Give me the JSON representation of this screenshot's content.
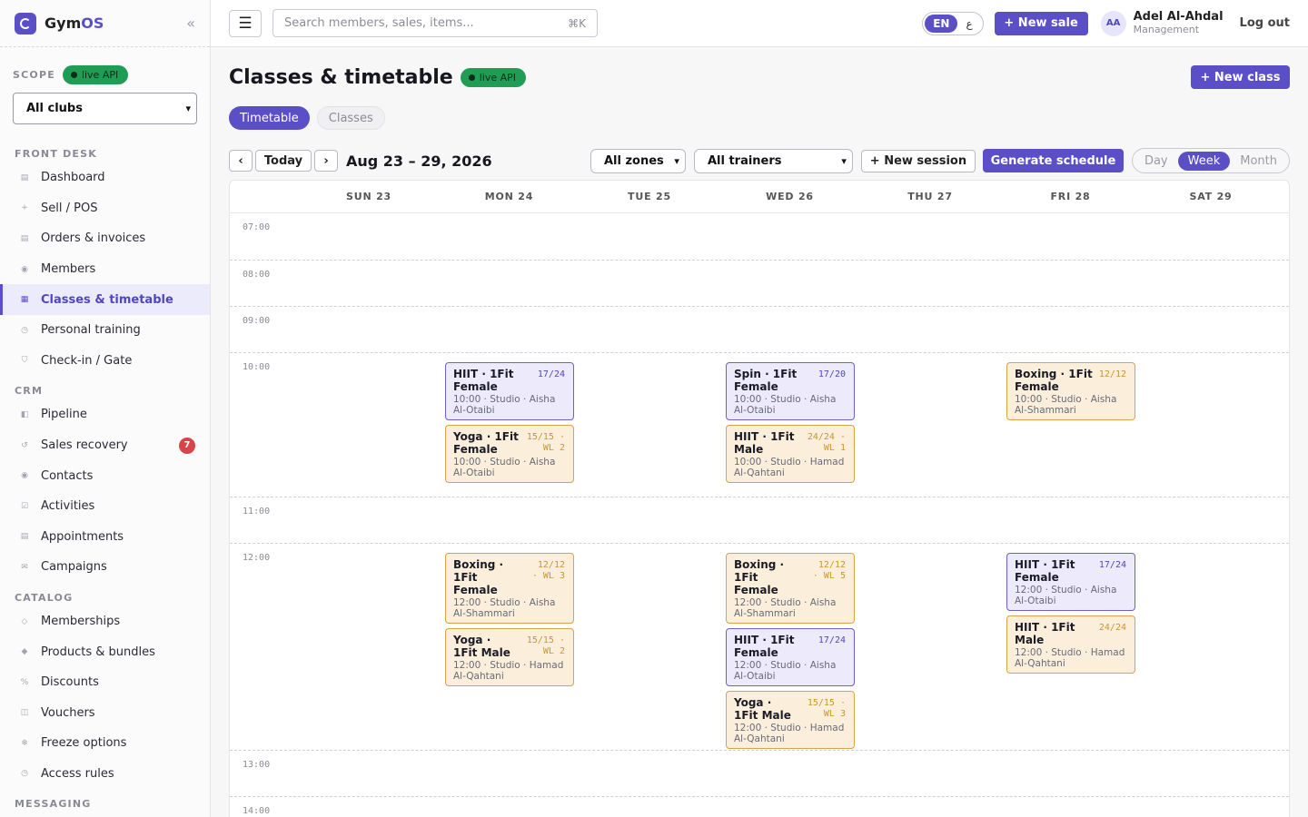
{
  "app": {
    "name_part1": "Gym",
    "name_part2": "OS"
  },
  "sidebar": {
    "scope_label": "SCOPE",
    "live_badge": "live API",
    "club_select": "All clubs",
    "groups": [
      {
        "label": "FRONT DESK",
        "items": [
          {
            "label": "Dashboard",
            "icon": "▤"
          },
          {
            "label": "Sell / POS",
            "icon": "+"
          },
          {
            "label": "Orders & invoices",
            "icon": "▤"
          },
          {
            "label": "Members",
            "icon": "◉"
          },
          {
            "label": "Classes & timetable",
            "icon": "▦",
            "active": true
          },
          {
            "label": "Personal training",
            "icon": "◷"
          },
          {
            "label": "Check-in / Gate",
            "icon": "⛉"
          }
        ]
      },
      {
        "label": "CRM",
        "items": [
          {
            "label": "Pipeline",
            "icon": "◧"
          },
          {
            "label": "Sales recovery",
            "icon": "↺",
            "badge": "7"
          },
          {
            "label": "Contacts",
            "icon": "◉"
          },
          {
            "label": "Activities",
            "icon": "☑"
          },
          {
            "label": "Appointments",
            "icon": "▤"
          },
          {
            "label": "Campaigns",
            "icon": "✉"
          }
        ]
      },
      {
        "label": "CATALOG",
        "items": [
          {
            "label": "Memberships",
            "icon": "◇"
          },
          {
            "label": "Products & bundles",
            "icon": "◆"
          },
          {
            "label": "Discounts",
            "icon": "%"
          },
          {
            "label": "Vouchers",
            "icon": "◫"
          },
          {
            "label": "Freeze options",
            "icon": "❄"
          },
          {
            "label": "Access rules",
            "icon": "◷"
          }
        ]
      },
      {
        "label": "MESSAGING",
        "items": []
      }
    ]
  },
  "topbar": {
    "search_placeholder": "Search members, sales, items...",
    "search_shortcut": "⌘K",
    "lang_active": "EN",
    "lang_other": "ع",
    "new_sale": "+ New sale",
    "user_initials": "AA",
    "user_name": "Adel Al-Ahdal",
    "user_role": "Management",
    "logout": "Log out"
  },
  "page": {
    "title": "Classes & timetable",
    "live_badge": "live API",
    "new_class": "+ New class",
    "tabs": [
      {
        "label": "Timetable",
        "active": true
      },
      {
        "label": "Classes",
        "active": false
      }
    ],
    "toolbar": {
      "prev": "‹",
      "today": "Today",
      "next": "›",
      "range": "Aug 23 – 29, 2026",
      "zones": "All zones",
      "trainers": "All trainers",
      "new_session": "+ New session",
      "generate": "Generate schedule",
      "views": [
        "Day",
        "Week",
        "Month"
      ],
      "active_view": "Week"
    }
  },
  "calendar": {
    "days": [
      "SUN 23",
      "MON 24",
      "TUE 25",
      "WED 26",
      "THU 27",
      "FRI 28",
      "SAT 29"
    ],
    "hours": [
      "07:00",
      "08:00",
      "09:00",
      "10:00",
      "11:00",
      "12:00",
      "13:00",
      "14:00"
    ],
    "events": [
      {
        "day": 1,
        "hour": "10:00",
        "slot": 0,
        "title": "HIIT · 1Fit Female",
        "capacity": "17/24",
        "meta": "10:00 · Studio · Aisha Al-Otaibi",
        "style": "violet"
      },
      {
        "day": 1,
        "hour": "10:00",
        "slot": 1,
        "title": "Yoga · 1Fit Female",
        "capacity": "15/15 · WL 2",
        "meta": "10:00 · Studio · Aisha Al-Otaibi",
        "style": "orange"
      },
      {
        "day": 3,
        "hour": "10:00",
        "slot": 0,
        "title": "Spin · 1Fit Female",
        "capacity": "17/20",
        "meta": "10:00 · Studio · Aisha Al-Otaibi",
        "style": "violet"
      },
      {
        "day": 3,
        "hour": "10:00",
        "slot": 1,
        "title": "HIIT · 1Fit Male",
        "capacity": "24/24 · WL 1",
        "meta": "10:00 · Studio · Hamad Al-Qahtani",
        "style": "orange"
      },
      {
        "day": 5,
        "hour": "10:00",
        "slot": 0,
        "title": "Boxing · 1Fit Female",
        "capacity": "12/12",
        "meta": "10:00 · Studio · Aisha Al-Shammari",
        "style": "orange"
      },
      {
        "day": 1,
        "hour": "12:00",
        "slot": 0,
        "title": "Boxing · 1Fit Female",
        "capacity": "12/12 · WL 3",
        "meta": "12:00 · Studio · Aisha Al-Shammari",
        "style": "orange"
      },
      {
        "day": 1,
        "hour": "12:00",
        "slot": 1,
        "title": "Yoga · 1Fit Male",
        "capacity": "15/15 · WL 2",
        "meta": "12:00 · Studio · Hamad Al-Qahtani",
        "style": "orange"
      },
      {
        "day": 3,
        "hour": "12:00",
        "slot": 0,
        "title": "Boxing · 1Fit Female",
        "capacity": "12/12 · WL 5",
        "meta": "12:00 · Studio · Aisha Al-Shammari",
        "style": "orange"
      },
      {
        "day": 3,
        "hour": "12:00",
        "slot": 1,
        "title": "HIIT · 1Fit Female",
        "capacity": "17/24",
        "meta": "12:00 · Studio · Aisha Al-Otaibi",
        "style": "violet"
      },
      {
        "day": 3,
        "hour": "12:00",
        "slot": 2,
        "title": "Yoga · 1Fit Male",
        "capacity": "15/15 · WL 3",
        "meta": "12:00 · Studio · Hamad Al-Qahtani",
        "style": "orange"
      },
      {
        "day": 5,
        "hour": "12:00",
        "slot": 0,
        "title": "HIIT · 1Fit Female",
        "capacity": "17/24",
        "meta": "12:00 · Studio · Aisha Al-Otaibi",
        "style": "violet"
      },
      {
        "day": 5,
        "hour": "12:00",
        "slot": 1,
        "title": "HIIT · 1Fit Male",
        "capacity": "24/24",
        "meta": "12:00 · Studio · Hamad Al-Qahtani",
        "style": "orange"
      }
    ]
  }
}
